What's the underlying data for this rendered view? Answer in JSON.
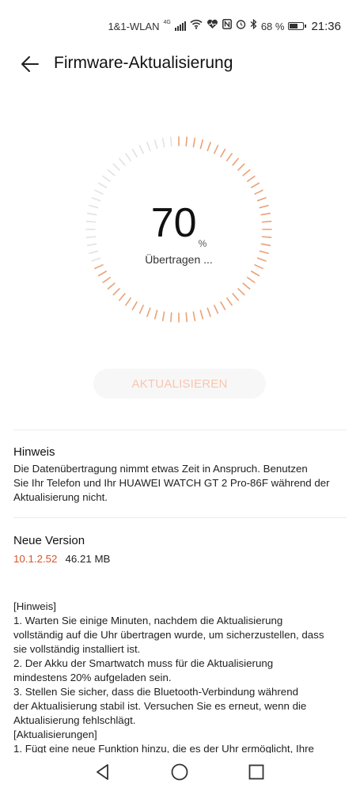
{
  "status_bar": {
    "carrier": "1&1-WLAN",
    "network": "4G",
    "battery_percent": "68 %",
    "battery_level": 0.68,
    "time": "21:36",
    "icons": [
      "signal-icon",
      "wifi-icon",
      "heart-icon",
      "nfc-icon",
      "alarm-icon",
      "bluetooth-icon",
      "battery-icon"
    ]
  },
  "header": {
    "title": "Firmware-Aktualisierung",
    "back_icon": "arrow-left-icon"
  },
  "progress": {
    "value": "70",
    "unit": "%",
    "fraction": 0.7,
    "status": "Übertragen ...",
    "accent_color": "#e9a277"
  },
  "update_button": {
    "label": "AKTUALISIEREN"
  },
  "hint": {
    "title": "Hinweis",
    "lines": [
      "Die Datenübertragung nimmt etwas Zeit in Anspruch. Benutzen",
      "Sie Ihr Telefon und Ihr HUAWEI WATCH GT 2 Pro-86F während der",
      "Aktualisierung nicht."
    ]
  },
  "new_version": {
    "title": "Neue Version",
    "version": "10.1.2.52",
    "size": "46.21 MB",
    "version_color": "#d5562c"
  },
  "release_notes": {
    "lines": [
      "[Hinweis]",
      "1. Warten Sie einige Minuten, nachdem die Aktualisierung",
      "vollständig auf die Uhr übertragen wurde, um sicherzustellen, dass",
      "sie vollständig installiert ist.",
      "2. Der Akku der Smartwatch muss für die Aktualisierung",
      "mindestens 20% aufgeladen sein.",
      "3. Stellen Sie sicher, dass die Bluetooth-Verbindung während",
      "der Aktualisierung stabil ist. Versuchen Sie es erneut, wenn die",
      "Aktualisierung fehlschlägt.",
      "[Aktualisierungen]",
      "1. Fügt eine neue Funktion hinzu, die es der Uhr ermöglicht, Ihre"
    ]
  },
  "nav_bar": {
    "buttons": [
      "back-triangle-icon",
      "home-circle-icon",
      "recents-square-icon"
    ]
  }
}
